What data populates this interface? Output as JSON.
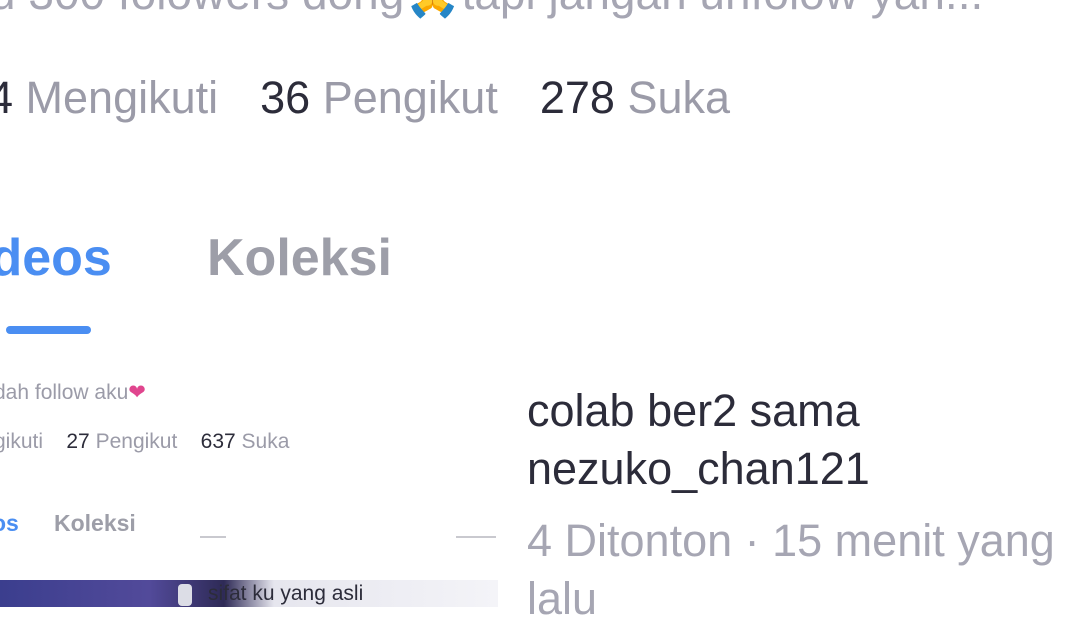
{
  "profile": {
    "bio": "u 300 folowers dong🙏tapi jangan unfolow yan...",
    "stats": [
      {
        "num": "4",
        "label": "Mengikuti"
      },
      {
        "num": "36",
        "label": "Pengikut"
      },
      {
        "num": "278",
        "label": "Suka"
      }
    ]
  },
  "tabs": {
    "videos": "ideos",
    "koleksi": "Koleksi"
  },
  "thumbnail": {
    "bio": "dah follow aku",
    "stats": [
      {
        "num": "",
        "label": "gikuti"
      },
      {
        "num": "27",
        "label": "Pengikut"
      },
      {
        "num": "637",
        "label": "Suka"
      }
    ],
    "tab_videos": "os",
    "tab_koleksi": "Koleksi",
    "video_caption": "sifat ku yang asli"
  },
  "video": {
    "title": "colab ber2 sama nezuko_chan121",
    "meta": "4 Ditonton · 15 menit yang lalu"
  },
  "colors": {
    "accent": "#4a8ef2",
    "text_dark": "#2c2c3a",
    "text_muted": "#9b9ba8",
    "heart": "#e0458e"
  }
}
